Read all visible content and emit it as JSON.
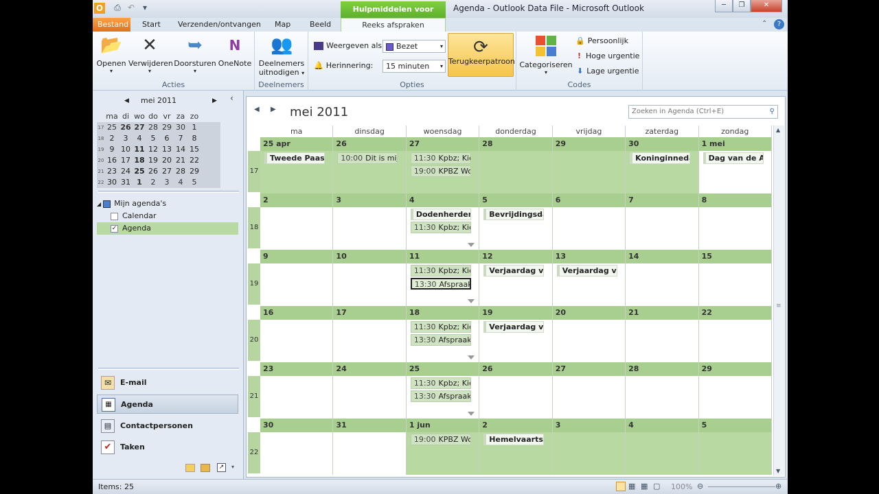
{
  "window": {
    "title": "Agenda - Outlook Data File - Microsoft Outlook",
    "context_tab": "Hulpmiddelen voor agenda"
  },
  "tabs": [
    "Bestand",
    "Start",
    "Verzenden/ontvangen",
    "Map",
    "Beeld",
    "Reeks afspraken"
  ],
  "ribbon": {
    "acties": {
      "label": "Acties",
      "buttons": [
        "Openen",
        "Verwijderen",
        "Doorsturen",
        "OneNote"
      ]
    },
    "deelnemers": {
      "label": "Deelnemers",
      "button_line1": "Deelnemers",
      "button_line2": "uitnodigen"
    },
    "opties": {
      "label": "Opties",
      "show_as_label": "Weergeven als:",
      "show_as_value": "Bezet",
      "reminder_label": "Herinnering:",
      "reminder_value": "15 minuten",
      "recurrence": "Terugkeerpatroon"
    },
    "codes": {
      "label": "Codes",
      "categorize": "Categoriseren",
      "private": "Persoonlijk",
      "high": "Hoge urgentie",
      "low": "Lage urgentie"
    }
  },
  "mini_calendar": {
    "title": "mei 2011",
    "dow": [
      "ma",
      "di",
      "wo",
      "do",
      "vr",
      "za",
      "zo"
    ],
    "weeks": [
      {
        "wk": "17",
        "days": [
          "25",
          "26",
          "27",
          "28",
          "29",
          "30",
          "1"
        ]
      },
      {
        "wk": "18",
        "days": [
          "2",
          "3",
          "4",
          "5",
          "6",
          "7",
          "8"
        ]
      },
      {
        "wk": "19",
        "days": [
          "9",
          "10",
          "11",
          "12",
          "13",
          "14",
          "15"
        ]
      },
      {
        "wk": "20",
        "days": [
          "16",
          "17",
          "18",
          "19",
          "20",
          "21",
          "22"
        ]
      },
      {
        "wk": "21",
        "days": [
          "23",
          "24",
          "25",
          "26",
          "27",
          "28",
          "29"
        ]
      },
      {
        "wk": "22",
        "days": [
          "30",
          "31",
          "1",
          "2",
          "3",
          "4",
          "5"
        ]
      }
    ]
  },
  "calendars": {
    "group": "Mijn agenda's",
    "items": [
      "Calendar",
      "Agenda"
    ]
  },
  "nav": [
    "E-mail",
    "Agenda",
    "Contactpersonen",
    "Taken"
  ],
  "calendar": {
    "month_title": "mei 2011",
    "search_placeholder": "Zoeken in Agenda (Ctrl+E)",
    "day_headers": [
      "ma",
      "dinsdag",
      "woensdag",
      "donderdag",
      "vrijdag",
      "zaterdag",
      "zondag"
    ],
    "weeks": [
      {
        "wk": "17",
        "days": [
          "25 apr",
          "26",
          "27",
          "28",
          "29",
          "30",
          "1 mei"
        ]
      },
      {
        "wk": "18",
        "days": [
          "2",
          "3",
          "4",
          "5",
          "6",
          "7",
          "8"
        ]
      },
      {
        "wk": "19",
        "days": [
          "9",
          "10",
          "11",
          "12",
          "13",
          "14",
          "15"
        ]
      },
      {
        "wk": "20",
        "days": [
          "16",
          "17",
          "18",
          "19",
          "20",
          "21",
          "22"
        ]
      },
      {
        "wk": "21",
        "days": [
          "23",
          "24",
          "25",
          "26",
          "27",
          "28",
          "29"
        ]
      },
      {
        "wk": "22",
        "days": [
          "30",
          "31",
          "1 jun",
          "2",
          "3",
          "4",
          "5"
        ]
      }
    ],
    "events": {
      "w0d0": [
        {
          "t": "",
          "s": "Tweede Paasdag"
        }
      ],
      "w0d1": [
        {
          "t": "10:00",
          "s": "Dit is mijn"
        }
      ],
      "w0d2": [
        {
          "t": "11:30",
          "s": "Kpbz; Kiel"
        },
        {
          "t": "19:00",
          "s": "KPBZ Wou"
        }
      ],
      "w0d5": [
        {
          "t": "",
          "s": "Koninginnedag"
        }
      ],
      "w0d6": [
        {
          "t": "",
          "s": "Dag van de Arbeid"
        }
      ],
      "w1d2": [
        {
          "t": "",
          "s": "Dodenherdenking"
        },
        {
          "t": "11:30",
          "s": "Kpbz; Kiel"
        }
      ],
      "w1d3": [
        {
          "t": "",
          "s": "Bevrijdingsdag"
        }
      ],
      "w2d2": [
        {
          "t": "11:30",
          "s": "Kpbz; Kiel"
        },
        {
          "t": "13:30",
          "s": "Afspraak"
        }
      ],
      "w2d3": [
        {
          "t": "",
          "s": "Verjaardag van"
        }
      ],
      "w2d4": [
        {
          "t": "",
          "s": "Verjaardag van"
        }
      ],
      "w3d2": [
        {
          "t": "11:30",
          "s": "Kpbz; Kiel"
        },
        {
          "t": "13:30",
          "s": "Afspraak"
        }
      ],
      "w3d3": [
        {
          "t": "",
          "s": "Verjaardag van"
        }
      ],
      "w4d2": [
        {
          "t": "11:30",
          "s": "Kpbz; Kiel"
        },
        {
          "t": "13:30",
          "s": "Afspraak"
        }
      ],
      "w5d2": [
        {
          "t": "19:00",
          "s": "KPBZ Wou"
        }
      ],
      "w5d3": [
        {
          "t": "",
          "s": "Hemelvaartsdag"
        }
      ]
    }
  },
  "status": {
    "items": "Items: 25",
    "zoom": "100%"
  }
}
